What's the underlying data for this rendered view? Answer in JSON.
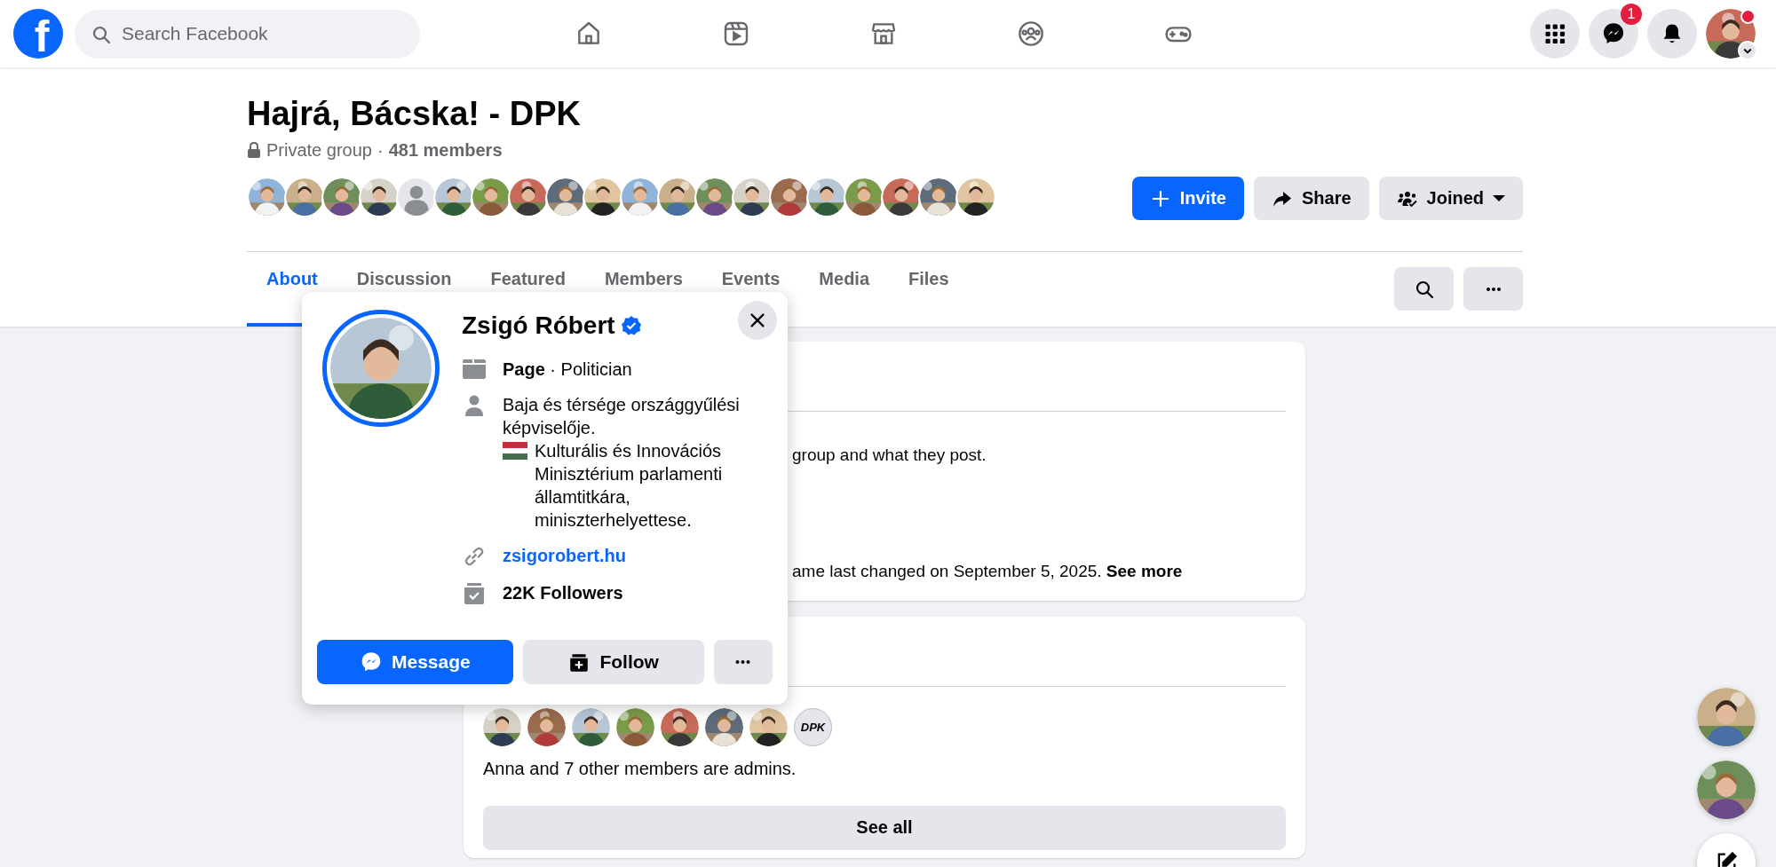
{
  "topbar": {
    "logo": "f",
    "search": {
      "placeholder": "Search Facebook"
    },
    "nav": [
      {
        "kind": "home"
      },
      {
        "kind": "reels"
      },
      {
        "kind": "marketplace"
      },
      {
        "kind": "groups"
      },
      {
        "kind": "gaming"
      }
    ],
    "actions": [
      {
        "kind": "menu"
      },
      {
        "kind": "messenger",
        "badge": "1"
      },
      {
        "kind": "notifications"
      }
    ],
    "account": {
      "kind": "picture",
      "unread": true
    }
  },
  "group": {
    "title": "Hajrá, Bácska! - DPK",
    "privacy": "Private group",
    "separator": "·",
    "members": "481 members",
    "member_avatars": [
      {
        "kind": "picture"
      },
      {
        "kind": "picture"
      },
      {
        "kind": "picture"
      },
      {
        "kind": "picture"
      },
      {
        "kind": "default"
      },
      {
        "kind": "picture"
      },
      {
        "kind": "picture"
      },
      {
        "kind": "picture"
      },
      {
        "kind": "picture"
      },
      {
        "kind": "picture"
      },
      {
        "kind": "picture"
      },
      {
        "kind": "picture"
      },
      {
        "kind": "picture"
      },
      {
        "kind": "picture"
      },
      {
        "kind": "picture"
      },
      {
        "kind": "picture"
      },
      {
        "kind": "picture"
      },
      {
        "kind": "picture"
      },
      {
        "kind": "picture"
      },
      {
        "kind": "picture"
      }
    ],
    "buttons": [
      {
        "kind": "invite",
        "label": "Invite"
      },
      {
        "kind": "share",
        "label": "Share"
      },
      {
        "kind": "joined",
        "label": "Joined"
      }
    ]
  },
  "tabs": [
    {
      "label": "About",
      "selected": true
    },
    {
      "label": "Discussion",
      "selected": false
    },
    {
      "label": "Featured",
      "selected": false
    },
    {
      "label": "Members",
      "selected": false
    },
    {
      "label": "Events",
      "selected": false
    },
    {
      "label": "Media",
      "selected": false
    },
    {
      "label": "Files",
      "selected": false
    }
  ],
  "tab_actions": [
    {
      "kind": "search"
    },
    {
      "kind": "more"
    }
  ],
  "about_card": {
    "lines": [
      "group and what they post.",
      "ame last changed on September 5, 2025. **See more**"
    ]
  },
  "admins_card": {
    "avatars": [
      {
        "kind": "picture"
      },
      {
        "kind": "picture"
      },
      {
        "kind": "picture"
      },
      {
        "kind": "picture"
      },
      {
        "kind": "picture"
      },
      {
        "kind": "picture"
      },
      {
        "kind": "picture"
      },
      {
        "kind": "logo",
        "text": "DPK"
      }
    ],
    "summary": "Anna and 7 other members are admins.",
    "button": "See all"
  },
  "hover_card": {
    "name": "Zsigó Róbert",
    "verified": true,
    "category": "**Page** · Politician",
    "bio": [
      "Baja és térsége országgyűlési képviselője.",
      "Kulturális és Innovációs Minisztérium parlamenti államtitkára, miniszterhelyettese."
    ],
    "website": "zsigorobert.hu",
    "followers": "22K Followers",
    "buttons": [
      {
        "kind": "message",
        "label": "Message"
      },
      {
        "kind": "follow",
        "label": "Follow"
      },
      {
        "kind": "more"
      }
    ]
  },
  "chat_heads": [
    {
      "kind": "picture"
    },
    {
      "kind": "picture"
    },
    {
      "kind": "compose"
    }
  ]
}
